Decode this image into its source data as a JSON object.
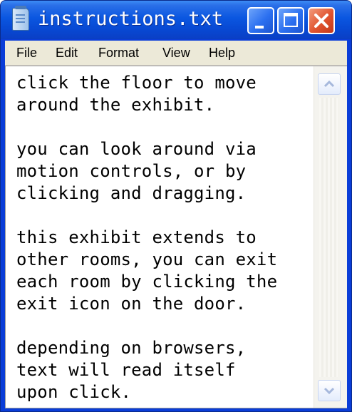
{
  "window": {
    "title": "instructions.txt",
    "icon": "notepad-icon",
    "accent_color": "#0a56e0",
    "close_color": "#e0532f"
  },
  "menu": {
    "file": "File",
    "edit": "Edit",
    "format": "Format",
    "view": "View",
    "help": "Help"
  },
  "document": {
    "text": "click the floor to move\naround the exhibit.\n\nyou can look around via\nmotion controls, or by\nclicking and dragging.\n\nthis exhibit extends to\nother rooms, you can exit\neach room by clicking the\nexit icon on the door.\n\ndepending on browsers,\ntext will read itself\nupon click."
  },
  "controls": {
    "minimize_icon": "minimize-icon",
    "maximize_icon": "maximize-icon",
    "close_icon": "close-icon",
    "scroll_up_icon": "chevron-up-icon",
    "scroll_down_icon": "chevron-down-icon"
  }
}
